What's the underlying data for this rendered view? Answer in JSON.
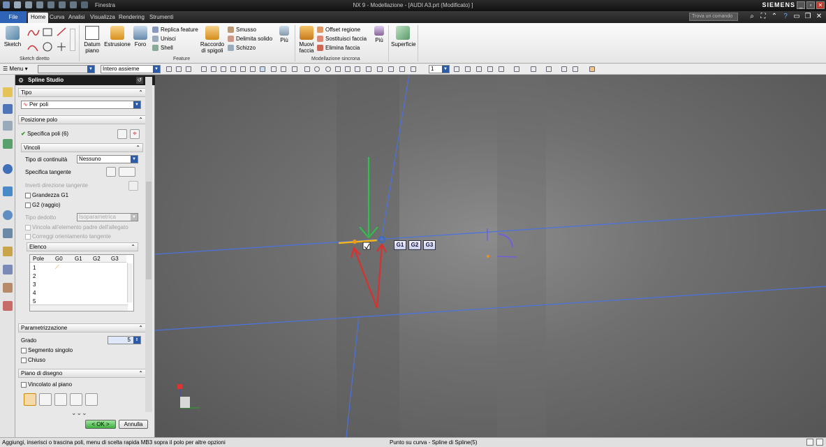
{
  "window": {
    "title": "NX 9 - Modellazione - [AUDI A3.prt (Modificato) ]",
    "brand": "SIEMENS",
    "quick_access_menu": "Finestra",
    "search_placeholder": "Trova un comando"
  },
  "tabs": [
    "File",
    "Home",
    "Curva",
    "Analisi",
    "Visualizza",
    "Rendering",
    "Strumenti"
  ],
  "active_tab": "Home",
  "ribbon": {
    "sketch_direct": {
      "sketch_label": "Sketch",
      "group_label": "Sketch diretto"
    },
    "feature": {
      "datum_label": "Datum\npiano",
      "estrusione_label": "Estrusione",
      "foro_label": "Foro",
      "replica_label": "Replica feature",
      "unisci_label": "Unisci",
      "shell_label": "Shell",
      "raccordo_label": "Raccordo\ndi spigoli",
      "smusso_label": "Smusso",
      "delimita_label": "Delimita solido",
      "schizzo_label": "Schizzo",
      "piu_label": "Più",
      "group_label": "Feature"
    },
    "sincrona": {
      "muovi_label": "Muovi\nfaccia",
      "offset_label": "Offset regione",
      "sostituisci_label": "Sostituisci faccia",
      "elimina_label": "Elimina faccia",
      "piu_label": "Più",
      "group_label": "Modellazione sincrona"
    },
    "superficie": {
      "label": "Superficie"
    }
  },
  "toolbar2": {
    "menu_label": "Menu",
    "assembly_filter": "Intero assieme",
    "layer_value": "1"
  },
  "panel": {
    "title": "Spline Studio",
    "tipo": {
      "header": "Tipo",
      "value": "Per poli"
    },
    "posizione": {
      "header": "Posizione polo",
      "specifica_poli": "Specifica poli (6)"
    },
    "vincoli": {
      "header": "Vincoli",
      "continuita_label": "Tipo di continuità",
      "continuita_value": "Nessuno",
      "tangente_label": "Specifica tangente",
      "inverti_label": "Inverti direzione tangente",
      "g1_label": "Grandezza G1",
      "g2_label": "G2 (raggio)",
      "dedotto_label": "Tipo dedotto",
      "dedotto_value": "Isoparametrica",
      "vincola_label": "Vincola all'elemento padre dell'allegato",
      "correggi_label": "Correggi orientamento tangente"
    },
    "elenco": {
      "header": "Elenco",
      "columns": [
        "Pole",
        "G0",
        "G1",
        "G2",
        "G3"
      ],
      "rows": [
        "1",
        "2",
        "3",
        "4",
        "5"
      ]
    },
    "param": {
      "header": "Parametrizzazione",
      "grado_label": "Grado",
      "grado_value": "5",
      "segmento_label": "Segmento singolo",
      "chiuso_label": "Chiuso"
    },
    "piano": {
      "header": "Piano di disegno",
      "vincolato_label": "Vincolato al piano"
    },
    "ok_label": "< OK >",
    "annulla_label": "Annulla"
  },
  "viewport": {
    "continuity_buttons": [
      "G1",
      "G2",
      "G3"
    ]
  },
  "status": {
    "left": "Aggiungi, inserisci o trascina poli, menu di scelta rapida MB3 sopra il polo per altre opzioni",
    "center": "Punto su curva - Spline di Spline(5)"
  }
}
